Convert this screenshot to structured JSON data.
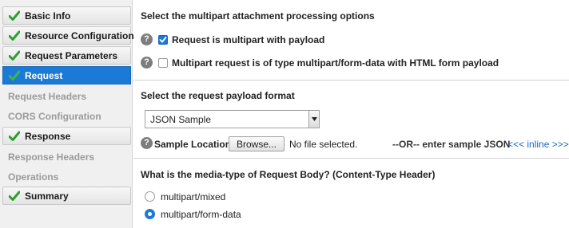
{
  "sidebar": {
    "items": [
      {
        "label": "Basic Info",
        "state": "done"
      },
      {
        "label": "Resource Configuration",
        "state": "done"
      },
      {
        "label": "Request Parameters",
        "state": "done"
      },
      {
        "label": "Request",
        "state": "active"
      },
      {
        "label": "Request Headers",
        "state": "disabled"
      },
      {
        "label": "CORS Configuration",
        "state": "disabled"
      },
      {
        "label": "Response",
        "state": "done"
      },
      {
        "label": "Response Headers",
        "state": "disabled"
      },
      {
        "label": "Operations",
        "state": "disabled"
      },
      {
        "label": "Summary",
        "state": "done"
      }
    ]
  },
  "multipart": {
    "heading": "Select the multipart attachment processing options",
    "option1_label": "Request is multipart with payload",
    "option1_checked": true,
    "option2_label": "Multipart request is of type multipart/form-data with HTML form payload",
    "option2_checked": false
  },
  "payload": {
    "heading": "Select the request payload format",
    "format_selected": "JSON Sample",
    "sample_location_label": "Sample Location",
    "browse_label": "Browse...",
    "file_status": "No file selected.",
    "or_text": "--OR-- enter sample JSON",
    "inline_link": "<<< inline >>>"
  },
  "media_type": {
    "heading": "What is the media-type of Request Body? (Content-Type Header)",
    "options": [
      {
        "label": "multipart/mixed",
        "selected": false
      },
      {
        "label": "multipart/form-data",
        "selected": true
      }
    ]
  },
  "colors": {
    "accent": "#1a7ad6",
    "check_green": "#2f9e2f",
    "link": "#1a66c4"
  }
}
